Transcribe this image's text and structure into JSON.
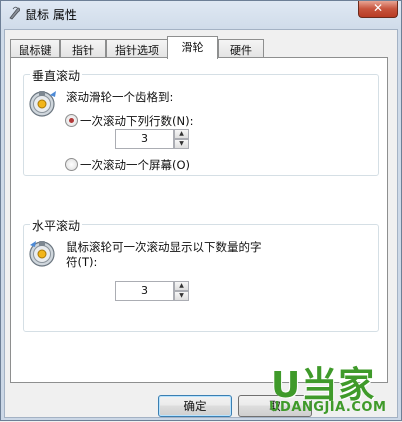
{
  "window": {
    "title": "鼠标 属性",
    "close_glyph": "✕"
  },
  "tabs": [
    {
      "label": "鼠标键"
    },
    {
      "label": "指针"
    },
    {
      "label": "指针选项"
    },
    {
      "label": "滑轮"
    },
    {
      "label": "硬件"
    }
  ],
  "vertical": {
    "legend": "垂直滚动",
    "prompt": "滚动滑轮一个齿格到:",
    "option_lines": "一次滚动下列行数(N):",
    "lines_value": "3",
    "option_screen": "一次滚动一个屏幕(O)",
    "selected": "lines"
  },
  "horizontal": {
    "legend": "水平滚动",
    "prompt_line1": "鼠标滚轮可一次滚动显示以下数量的字",
    "prompt_line2": "符(T):",
    "chars_value": "3"
  },
  "buttons": {
    "ok": "确定",
    "cancel": "取"
  },
  "watermark": {
    "main": "U当家",
    "sub": "UDANGJIA.COM"
  }
}
